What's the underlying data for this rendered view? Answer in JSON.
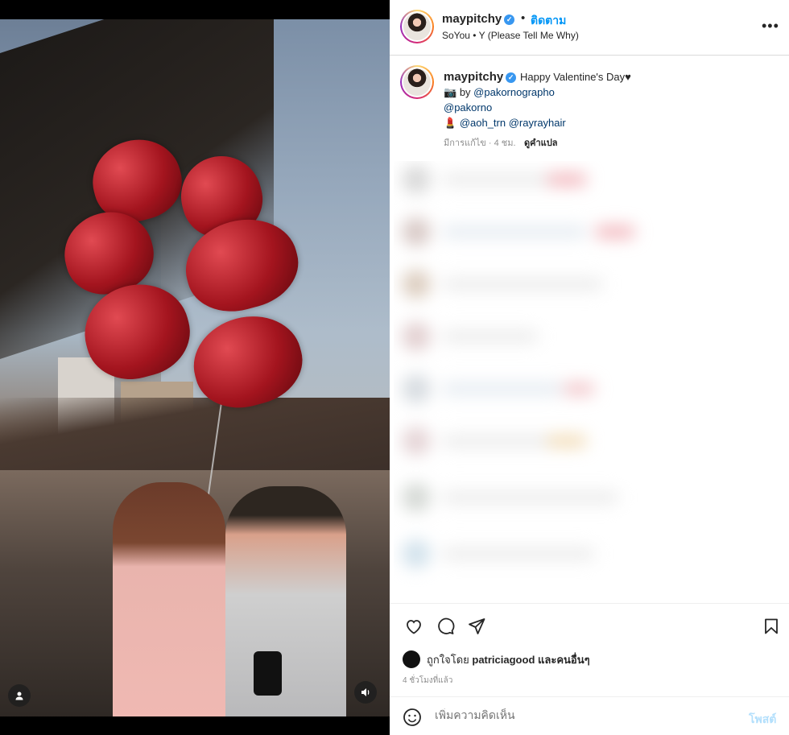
{
  "post": {
    "username": "maypitchy",
    "follow_label": "ติดตาม",
    "audio": "SoYou • Y (Please Tell Me Why)",
    "more_icon": "more-options-icon"
  },
  "caption": {
    "username": "maypitchy",
    "text": "Happy Valentine's Day♥",
    "line1_emoji": "📷",
    "line1_prefix": "by",
    "line1_mention": "@pakornographo",
    "line2_mention": "@pakorno",
    "line3_emoji": "💄",
    "line3_mention1": "@aoh_trn",
    "line3_mention2": "@rayrayhair",
    "meta": "มีการแก้ไข · 4 ชม.",
    "translate": "ดูคำแปล"
  },
  "likes": {
    "prefix": "ถูกใจโดย",
    "user": "patriciagood",
    "suffix": "และคนอื่นๆ"
  },
  "time": "4 ชั่วโมงที่แล้ว",
  "comment_box": {
    "placeholder": "เพิ่มความคิดเห็น",
    "post_label": "โพสต์"
  },
  "colors": {
    "accent": "#0095f6",
    "verified": "#3897f0"
  }
}
